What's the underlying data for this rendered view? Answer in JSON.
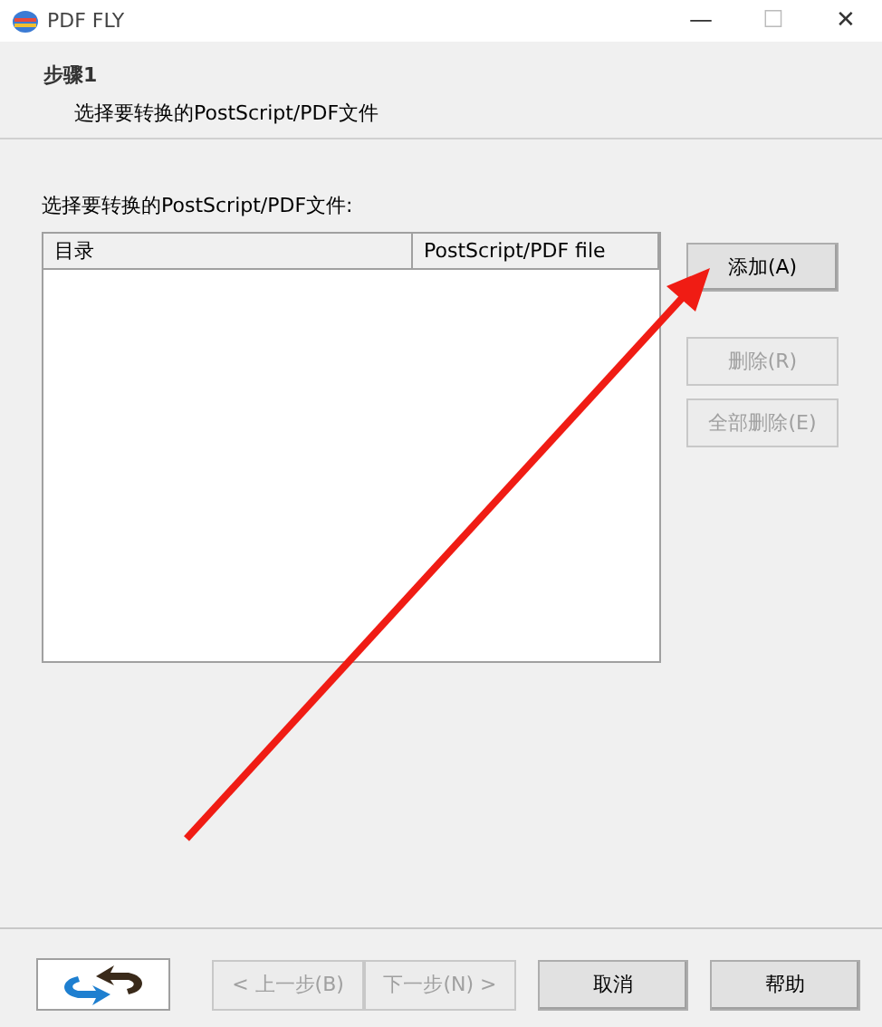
{
  "window": {
    "title": "PDF FLY",
    "controls": [
      "—",
      "☐",
      "✕"
    ]
  },
  "header": {
    "step": "步骤1",
    "subtitle": "选择要转换的PostScript/PDF文件"
  },
  "prompt": "选择要转换的PostScript/PDF文件:",
  "file_list": {
    "columns": [
      "目录",
      "PostScript/PDF file"
    ]
  },
  "side_buttons": [
    {
      "label": "添加(A)",
      "disabled": false
    },
    {
      "label": "删除(R)",
      "disabled": true
    },
    {
      "label": "全部删除(E)",
      "disabled": true
    }
  ],
  "footer_buttons": [
    {
      "label": "< 上一步(B)",
      "disabled": true
    },
    {
      "label": "下一步(N) >",
      "disabled": true
    },
    {
      "label": "取消",
      "disabled": false
    },
    {
      "label": "帮助",
      "disabled": false
    }
  ],
  "annotation": {
    "kind": "arrow"
  }
}
